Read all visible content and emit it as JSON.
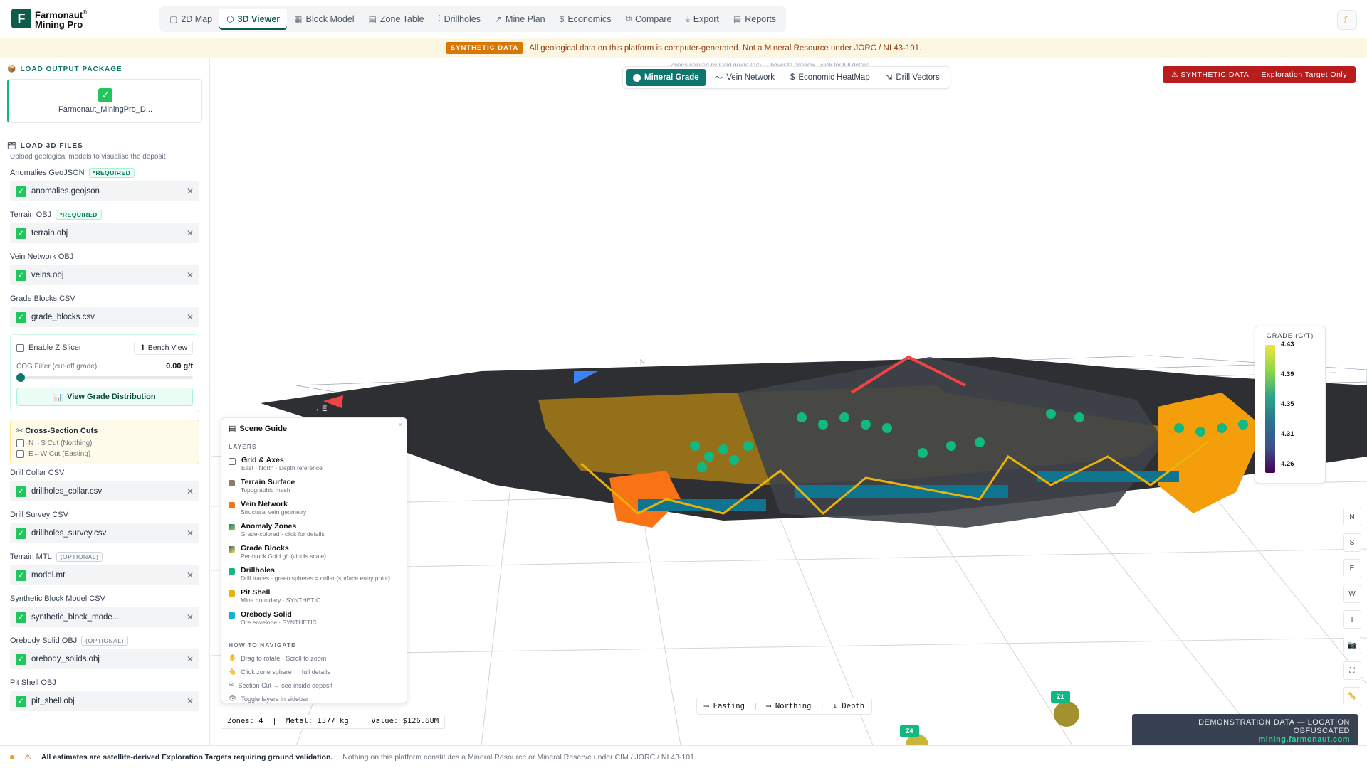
{
  "app": {
    "brand_line1": "Farmonaut",
    "brand_line2": "Mining Pro",
    "reg": "®"
  },
  "nav": {
    "tabs": [
      {
        "icon": "▢",
        "label": "2D Map"
      },
      {
        "icon": "⬡",
        "label": "3D Viewer"
      },
      {
        "icon": "▦",
        "label": "Block Model"
      },
      {
        "icon": "▤",
        "label": "Zone Table"
      },
      {
        "icon": "⫶",
        "label": "Drillholes"
      },
      {
        "icon": "↗",
        "label": "Mine Plan"
      },
      {
        "icon": "$",
        "label": "Economics"
      },
      {
        "icon": "⧉",
        "label": "Compare"
      },
      {
        "icon": "⤓",
        "label": "Export"
      },
      {
        "icon": "▤",
        "label": "Reports"
      }
    ],
    "active": "3D Viewer",
    "theme_icon": "moon-icon"
  },
  "banner": {
    "badge": "SYNTHETIC DATA",
    "text": "All geological data on this platform is computer-generated. Not a Mineral Resource under JORC / NI 43-101."
  },
  "sidebar": {
    "output_title": "LOAD OUTPUT PACKAGE",
    "output_file": "Farmonaut_MiningPro_D...",
    "files_title": "LOAD 3D FILES",
    "files_sub": "Upload geological models to visualise the deposit",
    "required_tag": "*REQUIRED",
    "optional_tag": "(OPTIONAL)",
    "groups": [
      {
        "label": "Anomalies GeoJSON",
        "file": "anomalies.geojson"
      },
      {
        "label": "Terrain OBJ",
        "file": "terrain.obj"
      },
      {
        "label": "Vein Network OBJ",
        "file": "veins.obj"
      },
      {
        "label": "Grade Blocks CSV",
        "file": "grade_blocks.csv"
      },
      {
        "label": "Drill Collar CSV",
        "file": "drillholes_collar.csv"
      },
      {
        "label": "Drill Survey CSV",
        "file": "drillholes_survey.csv"
      },
      {
        "label": "Terrain MTL",
        "file": "model.mtl"
      },
      {
        "label": "Synthetic Block Model CSV",
        "file": "synthetic_block_mode..."
      },
      {
        "label": "Orebody Solid OBJ",
        "file": "orebody_solids.obj"
      },
      {
        "label": "Pit Shell OBJ",
        "file": "pit_shell.obj"
      }
    ],
    "slicer": {
      "enable_label": "Enable Z Slicer",
      "bench_label": "Bench View",
      "cog_label": "COG Filter (cut-off grade)",
      "cog_value": "0.00 g/t",
      "grade_btn": "View Grade Distribution"
    },
    "cross": {
      "title": "Cross-Section Cuts",
      "ns": "N↔S Cut (Northing)",
      "ew": "E↔W Cut (Easting)"
    }
  },
  "viewer": {
    "hint": "Zones colored by Gold grade (g/t) — hover to preview · click for full details",
    "modes": [
      {
        "icon": "",
        "label": "Mineral Grade"
      },
      {
        "icon": "〜",
        "label": "Vein Network"
      },
      {
        "icon": "$",
        "label": "Economic HeatMap"
      },
      {
        "icon": "⇲",
        "label": "Drill Vectors"
      }
    ],
    "alert": "⚠ SYNTHETIC DATA — Exploration Target Only",
    "legend": {
      "title": "GRADE (G/T)",
      "ticks": [
        "4.43",
        "4.39",
        "4.35",
        "4.31",
        "4.26"
      ]
    },
    "side_tools": [
      "N",
      "S",
      "E",
      "W",
      "T",
      "📷",
      "⛶",
      "📏"
    ],
    "axis_markers": {
      "east": "→ E",
      "north": "→ N"
    },
    "zones": [
      "Z1",
      "Z4"
    ],
    "stats": "Zones: 4  |  Metal: 1377 kg  |  Value: $126.68M",
    "axes": {
      "easting": "⟶ Easting",
      "northing": "⟶ Northing",
      "depth": "↓ Depth"
    },
    "demo_line1": "DEMONSTRATION DATA — LOCATION OBFUSCATED",
    "demo_line2": "mining.farmonaut.com"
  },
  "scene_guide": {
    "title": "Scene Guide",
    "close": "×",
    "layers_title": "LAYERS",
    "layers": [
      {
        "name": "Grid & Axes",
        "desc": "East · North · Depth reference",
        "color": ""
      },
      {
        "name": "Terrain Surface",
        "desc": "Topographic mesh",
        "color": "#8b7d6b"
      },
      {
        "name": "Vein Network",
        "desc": "Structural vein geometry",
        "color": "#f97316"
      },
      {
        "name": "Anomaly Zones",
        "desc": "Grade-colored · click for details",
        "color": "#2c718e"
      },
      {
        "name": "Grade Blocks",
        "desc": "Per-block Gold g/t (viridis scale)",
        "color": "#3b528b"
      },
      {
        "name": "Drillholes",
        "desc": "Drill traces · green spheres = collar (surface entry point)",
        "color": "#10b981"
      },
      {
        "name": "Pit Shell",
        "desc": "Mine boundary · SYNTHETIC",
        "color": "#eab308"
      },
      {
        "name": "Orebody Solid",
        "desc": "Ore envelope · SYNTHETIC",
        "color": "#06b6d4"
      }
    ],
    "nav_title": "HOW TO NAVIGATE",
    "nav": [
      {
        "icon": "✋",
        "text": "Drag to rotate · Scroll to zoom"
      },
      {
        "icon": "👆",
        "text": "Click zone sphere → full details"
      },
      {
        "icon": "✂",
        "text": "Section Cut → see inside deposit"
      },
      {
        "icon": "👁",
        "text": "Toggle layers in sidebar"
      }
    ]
  },
  "footer": {
    "warning": "All estimates are satellite-derived Exploration Targets requiring ground validation.",
    "disclaimer": "Nothing on this platform constitutes a Mineral Resource or Mineral Reserve under CIM / JORC / NI 43-101."
  }
}
